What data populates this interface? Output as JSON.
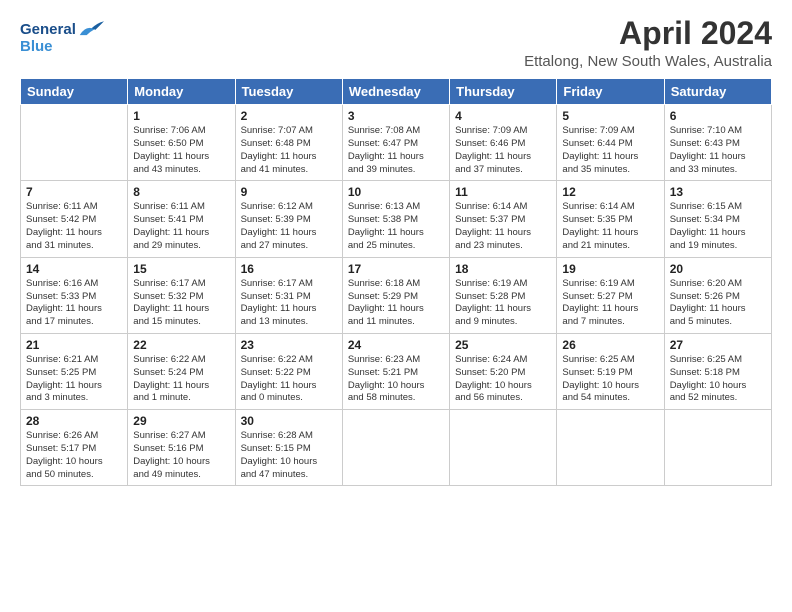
{
  "header": {
    "logo_line1": "General",
    "logo_line2": "Blue",
    "title": "April 2024",
    "subtitle": "Ettalong, New South Wales, Australia"
  },
  "weekdays": [
    "Sunday",
    "Monday",
    "Tuesday",
    "Wednesday",
    "Thursday",
    "Friday",
    "Saturday"
  ],
  "weeks": [
    [
      {
        "day": "",
        "info": ""
      },
      {
        "day": "1",
        "info": "Sunrise: 7:06 AM\nSunset: 6:50 PM\nDaylight: 11 hours\nand 43 minutes."
      },
      {
        "day": "2",
        "info": "Sunrise: 7:07 AM\nSunset: 6:48 PM\nDaylight: 11 hours\nand 41 minutes."
      },
      {
        "day": "3",
        "info": "Sunrise: 7:08 AM\nSunset: 6:47 PM\nDaylight: 11 hours\nand 39 minutes."
      },
      {
        "day": "4",
        "info": "Sunrise: 7:09 AM\nSunset: 6:46 PM\nDaylight: 11 hours\nand 37 minutes."
      },
      {
        "day": "5",
        "info": "Sunrise: 7:09 AM\nSunset: 6:44 PM\nDaylight: 11 hours\nand 35 minutes."
      },
      {
        "day": "6",
        "info": "Sunrise: 7:10 AM\nSunset: 6:43 PM\nDaylight: 11 hours\nand 33 minutes."
      }
    ],
    [
      {
        "day": "7",
        "info": "Sunrise: 6:11 AM\nSunset: 5:42 PM\nDaylight: 11 hours\nand 31 minutes."
      },
      {
        "day": "8",
        "info": "Sunrise: 6:11 AM\nSunset: 5:41 PM\nDaylight: 11 hours\nand 29 minutes."
      },
      {
        "day": "9",
        "info": "Sunrise: 6:12 AM\nSunset: 5:39 PM\nDaylight: 11 hours\nand 27 minutes."
      },
      {
        "day": "10",
        "info": "Sunrise: 6:13 AM\nSunset: 5:38 PM\nDaylight: 11 hours\nand 25 minutes."
      },
      {
        "day": "11",
        "info": "Sunrise: 6:14 AM\nSunset: 5:37 PM\nDaylight: 11 hours\nand 23 minutes."
      },
      {
        "day": "12",
        "info": "Sunrise: 6:14 AM\nSunset: 5:35 PM\nDaylight: 11 hours\nand 21 minutes."
      },
      {
        "day": "13",
        "info": "Sunrise: 6:15 AM\nSunset: 5:34 PM\nDaylight: 11 hours\nand 19 minutes."
      }
    ],
    [
      {
        "day": "14",
        "info": "Sunrise: 6:16 AM\nSunset: 5:33 PM\nDaylight: 11 hours\nand 17 minutes."
      },
      {
        "day": "15",
        "info": "Sunrise: 6:17 AM\nSunset: 5:32 PM\nDaylight: 11 hours\nand 15 minutes."
      },
      {
        "day": "16",
        "info": "Sunrise: 6:17 AM\nSunset: 5:31 PM\nDaylight: 11 hours\nand 13 minutes."
      },
      {
        "day": "17",
        "info": "Sunrise: 6:18 AM\nSunset: 5:29 PM\nDaylight: 11 hours\nand 11 minutes."
      },
      {
        "day": "18",
        "info": "Sunrise: 6:19 AM\nSunset: 5:28 PM\nDaylight: 11 hours\nand 9 minutes."
      },
      {
        "day": "19",
        "info": "Sunrise: 6:19 AM\nSunset: 5:27 PM\nDaylight: 11 hours\nand 7 minutes."
      },
      {
        "day": "20",
        "info": "Sunrise: 6:20 AM\nSunset: 5:26 PM\nDaylight: 11 hours\nand 5 minutes."
      }
    ],
    [
      {
        "day": "21",
        "info": "Sunrise: 6:21 AM\nSunset: 5:25 PM\nDaylight: 11 hours\nand 3 minutes."
      },
      {
        "day": "22",
        "info": "Sunrise: 6:22 AM\nSunset: 5:24 PM\nDaylight: 11 hours\nand 1 minute."
      },
      {
        "day": "23",
        "info": "Sunrise: 6:22 AM\nSunset: 5:22 PM\nDaylight: 11 hours\nand 0 minutes."
      },
      {
        "day": "24",
        "info": "Sunrise: 6:23 AM\nSunset: 5:21 PM\nDaylight: 10 hours\nand 58 minutes."
      },
      {
        "day": "25",
        "info": "Sunrise: 6:24 AM\nSunset: 5:20 PM\nDaylight: 10 hours\nand 56 minutes."
      },
      {
        "day": "26",
        "info": "Sunrise: 6:25 AM\nSunset: 5:19 PM\nDaylight: 10 hours\nand 54 minutes."
      },
      {
        "day": "27",
        "info": "Sunrise: 6:25 AM\nSunset: 5:18 PM\nDaylight: 10 hours\nand 52 minutes."
      }
    ],
    [
      {
        "day": "28",
        "info": "Sunrise: 6:26 AM\nSunset: 5:17 PM\nDaylight: 10 hours\nand 50 minutes."
      },
      {
        "day": "29",
        "info": "Sunrise: 6:27 AM\nSunset: 5:16 PM\nDaylight: 10 hours\nand 49 minutes."
      },
      {
        "day": "30",
        "info": "Sunrise: 6:28 AM\nSunset: 5:15 PM\nDaylight: 10 hours\nand 47 minutes."
      },
      {
        "day": "",
        "info": ""
      },
      {
        "day": "",
        "info": ""
      },
      {
        "day": "",
        "info": ""
      },
      {
        "day": "",
        "info": ""
      }
    ]
  ]
}
